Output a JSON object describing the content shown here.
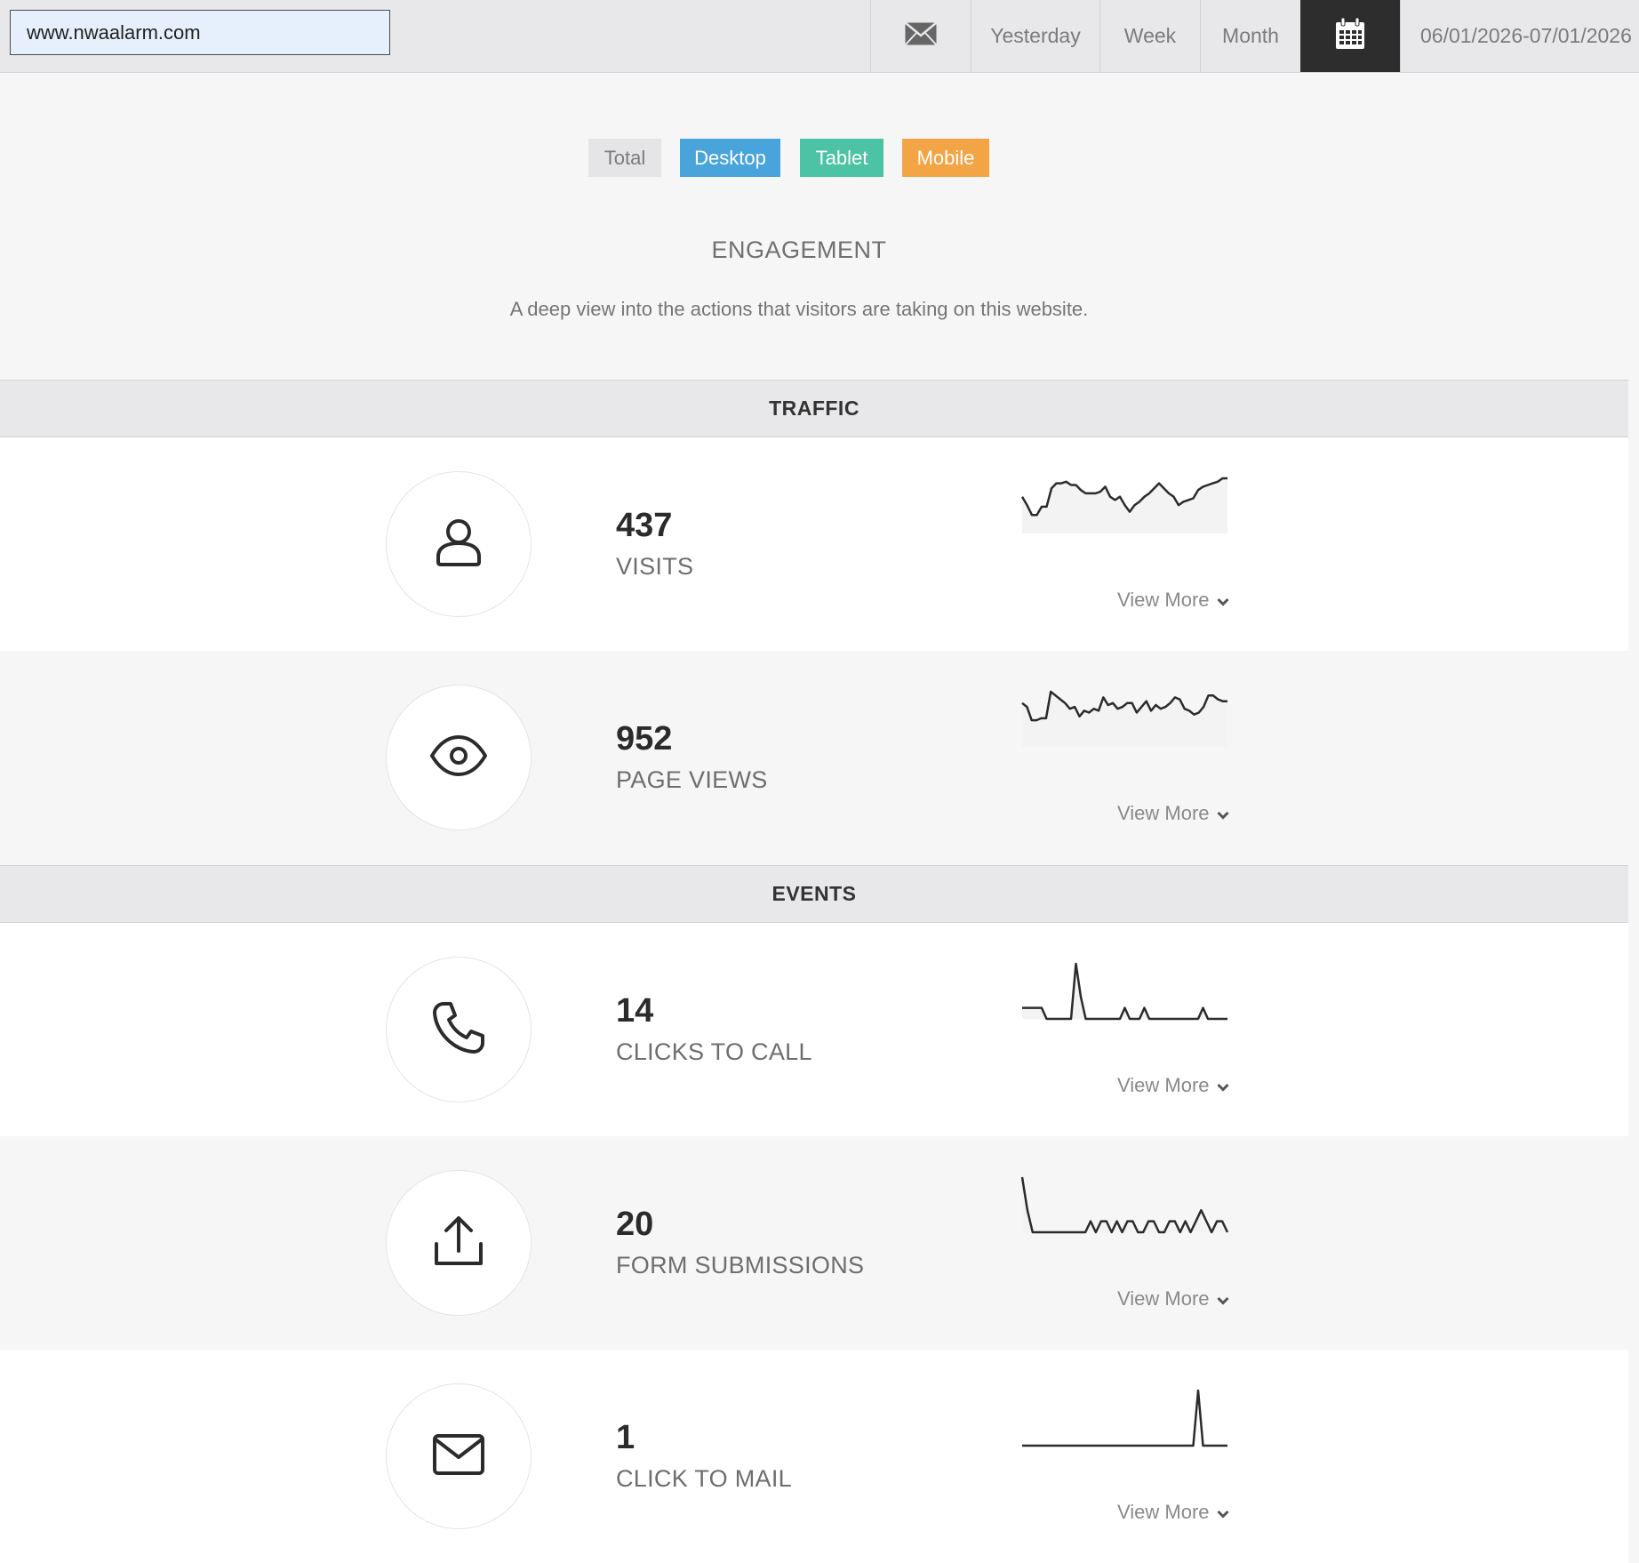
{
  "topbar": {
    "site_value": "www.nwaalarm.com",
    "mail_icon": "envelope-icon",
    "ranges": [
      "Yesterday",
      "Week",
      "Month"
    ],
    "calendar_icon": "calendar-icon",
    "date_range": "06/01/2026-07/01/2026"
  },
  "filters": [
    "Total",
    "Desktop",
    "Tablet",
    "Mobile"
  ],
  "filter_colors": {
    "Total": "#e5e5e7",
    "Desktop": "#4aa4dc",
    "Tablet": "#4cc3a2",
    "Mobile": "#f3a545"
  },
  "page": {
    "title": "ENGAGEMENT",
    "subtitle": "A deep view into the actions that visitors are taking on this website."
  },
  "sections": {
    "traffic": "TRAFFIC",
    "events": "EVENTS"
  },
  "view_more": "View More",
  "metrics": [
    {
      "icon": "user-icon",
      "value": "437",
      "label": "VISITS",
      "sparkline": [
        22,
        17,
        11,
        11,
        16,
        16,
        27,
        30,
        30,
        31,
        29,
        29,
        26,
        24,
        24,
        24,
        25,
        28,
        22,
        20,
        22,
        17,
        13,
        17,
        19,
        22,
        24,
        27,
        30,
        27,
        24,
        22,
        17,
        19,
        20,
        21,
        26,
        28,
        29,
        30,
        31,
        33,
        33
      ]
    },
    {
      "icon": "eye-icon",
      "value": "952",
      "label": "PAGE VIEWS",
      "sparkline": [
        23,
        21,
        14,
        14,
        15,
        15,
        29,
        27,
        25,
        23,
        20,
        21,
        16,
        19,
        18,
        20,
        19,
        26,
        22,
        23,
        20,
        21,
        23,
        23,
        18,
        21,
        24,
        19,
        22,
        20,
        21,
        23,
        26,
        25,
        20,
        19,
        17,
        18,
        21,
        27,
        27,
        25,
        24,
        24
      ]
    },
    {
      "icon": "phone-icon",
      "value": "14",
      "label": "CLICKS TO CALL",
      "sparkline": [
        1,
        1,
        1,
        1,
        1,
        0,
        0,
        0,
        0,
        0,
        0,
        5,
        2,
        0,
        0,
        0,
        0,
        0,
        0,
        0,
        0,
        1,
        0,
        0,
        0,
        1,
        0,
        0,
        0,
        0,
        0,
        0,
        0,
        0,
        0,
        0,
        0,
        1,
        0,
        0,
        0,
        0,
        0
      ]
    },
    {
      "icon": "upload-icon",
      "value": "20",
      "label": "FORM SUBMISSIONS",
      "sparkline": [
        5,
        2,
        0,
        0,
        0,
        0,
        0,
        0,
        0,
        0,
        0,
        0,
        0,
        1,
        0,
        1,
        1,
        0,
        1,
        0,
        1,
        1,
        0,
        0,
        1,
        1,
        0,
        0,
        1,
        1,
        0,
        1,
        0,
        1,
        2,
        1,
        0,
        1,
        1,
        0
      ]
    },
    {
      "icon": "mail-icon",
      "value": "1",
      "label": "CLICK TO MAIL",
      "sparkline": [
        0,
        0,
        0,
        0,
        0,
        0,
        0,
        0,
        0,
        0,
        0,
        0,
        0,
        0,
        0,
        0,
        0,
        0,
        0,
        0,
        0,
        0,
        0,
        0,
        0,
        0,
        0,
        0,
        0,
        0,
        0,
        0,
        0,
        0,
        0,
        0,
        1,
        0,
        0,
        0,
        0,
        0,
        0
      ]
    }
  ]
}
